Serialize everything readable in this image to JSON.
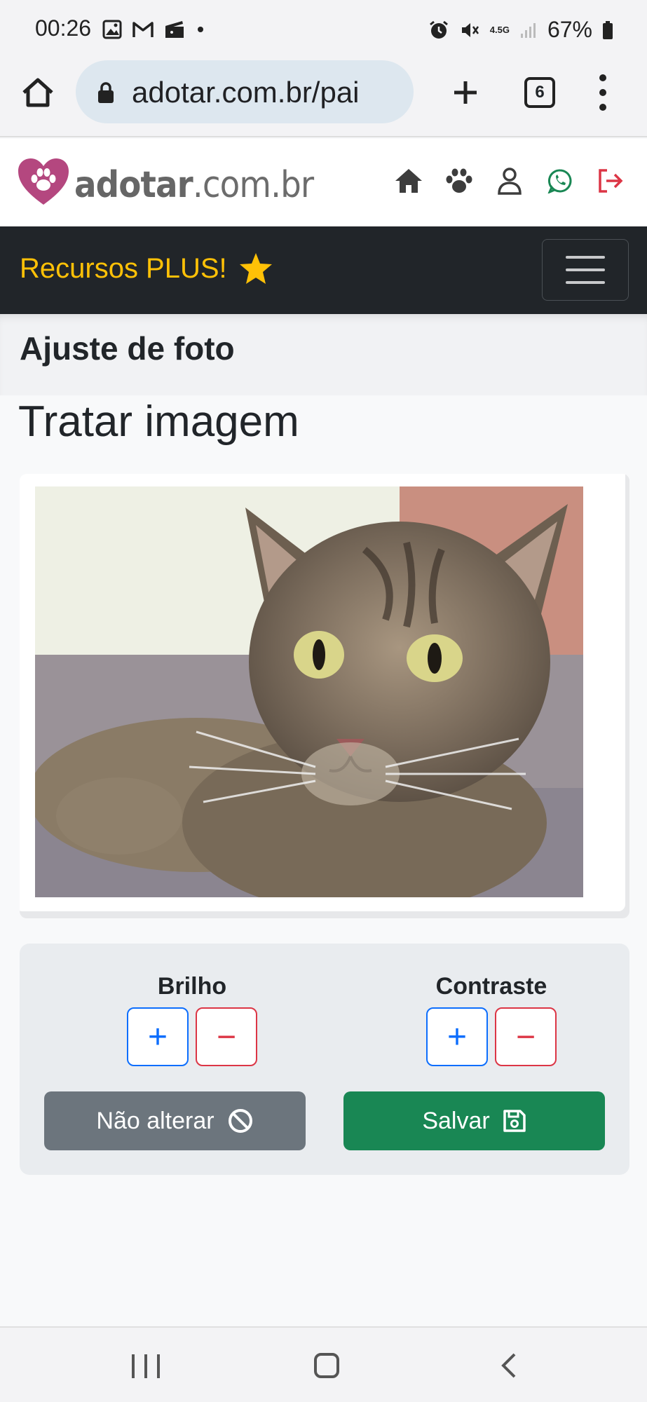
{
  "status_bar": {
    "time": "00:26",
    "network": "4.5G",
    "battery": "67%"
  },
  "browser": {
    "url": "adotar.com.br/pai",
    "tab_count": "6"
  },
  "site": {
    "logo_text_bold": "adotar",
    "logo_text_rest": ".com.br"
  },
  "navbar": {
    "brand": "Recursos PLUS!"
  },
  "page": {
    "heading": "Ajuste de foto",
    "section_title": "Tratar imagem"
  },
  "controls": {
    "brightness_label": "Brilho",
    "contrast_label": "Contraste",
    "plus_symbol": "+",
    "minus_symbol": "−",
    "cancel_label": "Não alterar",
    "save_label": "Salvar"
  },
  "colors": {
    "brand_yellow": "#ffc107",
    "navbar_bg": "#212529",
    "primary": "#0d6efd",
    "danger": "#dc3545",
    "success": "#198754",
    "secondary": "#6c757d",
    "logo_heart": "#b4477f",
    "whatsapp": "#198754"
  }
}
